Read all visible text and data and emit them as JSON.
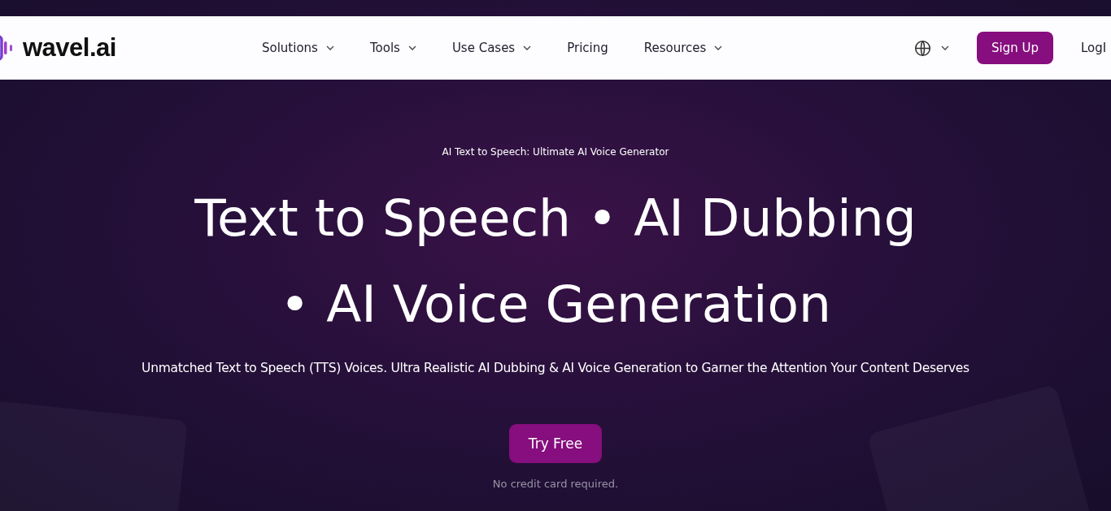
{
  "nav": {
    "logo": "wavel.ai",
    "menu": [
      {
        "label": "Solutions",
        "dropdown": true
      },
      {
        "label": "Tools",
        "dropdown": true
      },
      {
        "label": "Use Cases",
        "dropdown": true
      },
      {
        "label": "Pricing",
        "dropdown": false
      },
      {
        "label": "Resources",
        "dropdown": true
      }
    ],
    "signup": "Sign Up",
    "login": "LogI"
  },
  "hero": {
    "eyebrow": "AI Text to Speech: Ultimate AI Voice Generator",
    "headline_lines": [
      "Text to Speech • AI Dubbing",
      "• AI Voice Generation"
    ],
    "subtitle": "Unmatched Text to Speech (TTS) Voices. Ultra Realistic AI Dubbing & AI Voice Generation to Garner the Attention Your Content Deserves",
    "cta": "Try Free",
    "note": "No credit card required."
  }
}
